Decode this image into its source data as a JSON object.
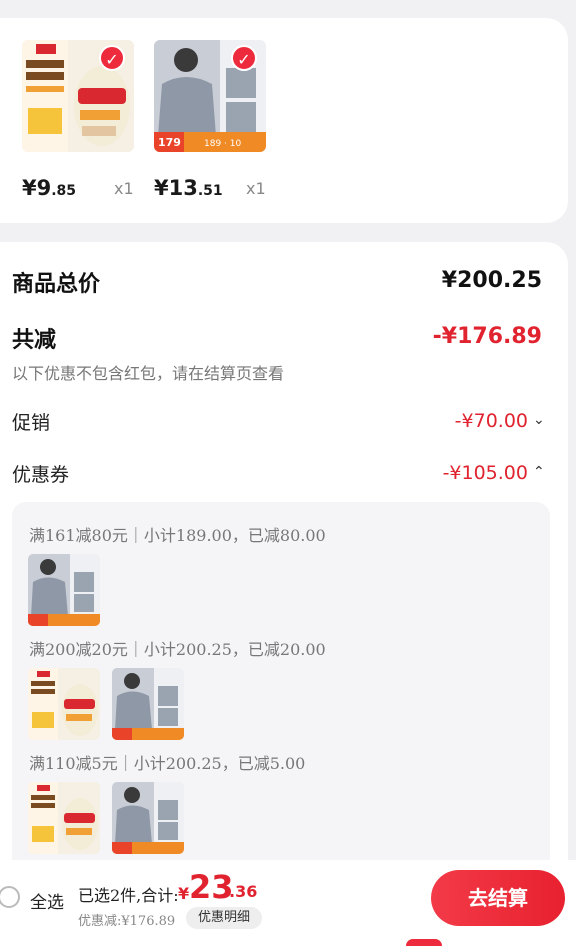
{
  "products": [
    {
      "price_int": "¥9",
      "price_dec": ".85",
      "qty": "x1",
      "image": "product-jar-image"
    },
    {
      "price_int": "¥13",
      "price_dec": ".51",
      "qty": "x1",
      "image": "product-jacket-image"
    }
  ],
  "summary": {
    "total_label": "商品总价",
    "total_value": "¥200.25",
    "reduce_label": "共减",
    "reduce_value": "-¥176.89",
    "note": "以下优惠不包含红包，请在结算页查看",
    "promo_label": "促销",
    "promo_value": "-¥70.00",
    "coupon_label": "优惠券",
    "coupon_value": "-¥105.00"
  },
  "coupon_rules": [
    {
      "text": "满161减80元｜小计189.00，已减80.00"
    },
    {
      "text": "满200减20元｜小计200.25，已减20.00"
    },
    {
      "text": "满110减5元｜小计200.25，已减5.00"
    }
  ],
  "bottom": {
    "select_all": "全选",
    "summary": "已选2件,合计:",
    "currency": "¥",
    "total_int": "23",
    "total_dec": ".36",
    "discount": "优惠减:¥176.89",
    "detail_btn": "优惠明细",
    "checkout": "去结算"
  },
  "colors": {
    "accent": "#e0232f",
    "brand_button": "#ee2b3c"
  }
}
